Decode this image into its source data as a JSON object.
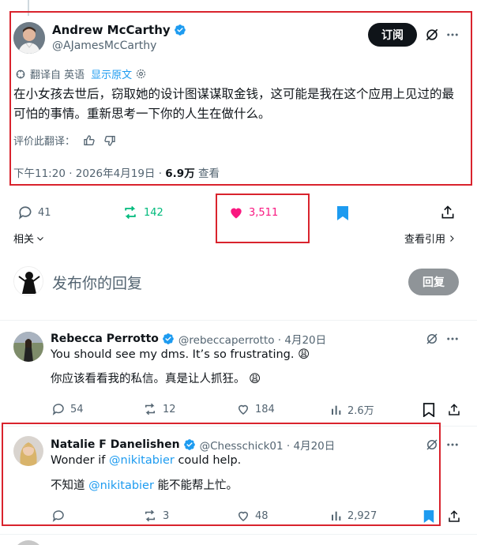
{
  "main_tweet": {
    "author_name": "Andrew McCarthy",
    "author_handle": "@AJamesMcCarthy",
    "subscribe_label": "订阅",
    "translated_from": "翻译自 英语",
    "show_original": "显示原文",
    "text": "在小女孩去世后，窃取她的设计图谋谋取金钱，这可能是我在这个应用上见过的最可怕的事情。重新思考一下你的人生在做什么。",
    "rate_translation": "评价此翻译：",
    "timestamp": "下午11:20 · 2026年4月19日 · ",
    "views_count": "6.9万",
    "views_label": " 查看"
  },
  "main_actions": {
    "replies": "41",
    "reposts": "142",
    "likes": "3,511",
    "related_label": "相关",
    "view_quotes_label": "查看引用"
  },
  "reply_composer": {
    "placeholder": "发布你的回复",
    "button_label": "回复"
  },
  "replies": [
    {
      "author_name": "Rebecca Perrotto",
      "author_handle": "@rebeccaperrotto · 4月20日",
      "text": "You should see my dms. It’s so frustrating. 😩",
      "translation": "你应该看看我的私信。真是让人抓狂。 😩",
      "comments": "54",
      "reposts": "12",
      "likes": "184",
      "views": "2.6万"
    },
    {
      "author_name": "Natalie F Danelishen",
      "author_handle": "@Chesschick01 · 4月20日",
      "text_prefix": "Wonder if ",
      "mention": "@nikitabier",
      "text_suffix": " could help.",
      "translation_prefix": "不知道 ",
      "translation_mention": "@nikitabier",
      "translation_suffix": " 能不能帮上忙。",
      "comments": "",
      "reposts": "3",
      "likes": "48",
      "views": "2,927"
    }
  ],
  "colors": {
    "accent_blue": "#1d9bf0",
    "repost_green": "#00ba7c",
    "like_pink": "#f91880",
    "highlight_red": "#d9232d",
    "text_primary": "#0f1419",
    "text_secondary": "#536471"
  }
}
